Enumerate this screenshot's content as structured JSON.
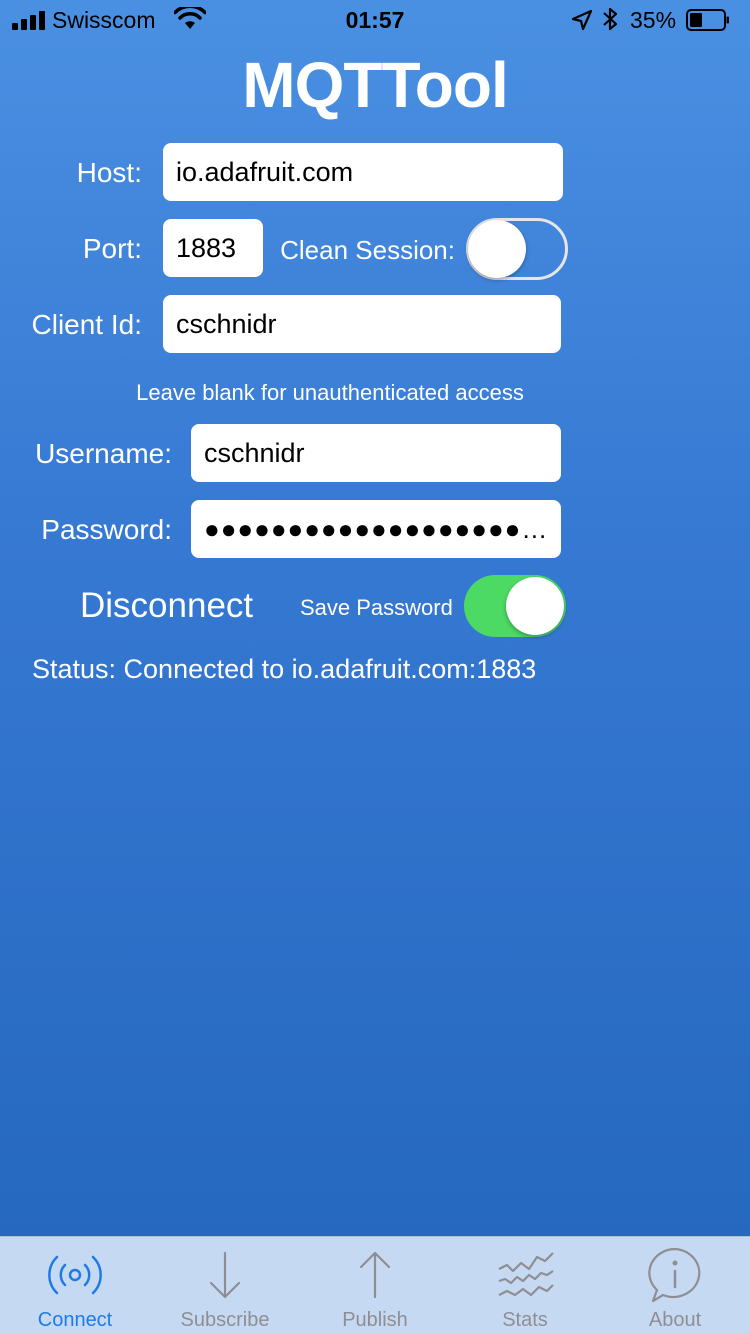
{
  "status_bar": {
    "carrier": "Swisscom",
    "time": "01:57",
    "battery": "35%"
  },
  "app": {
    "title": "MQTTool"
  },
  "form": {
    "host_label": "Host:",
    "host_value": "io.adafruit.com",
    "port_label": "Port:",
    "port_value": "1883",
    "clean_session_label": "Clean Session:",
    "clean_session_on": false,
    "client_id_label": "Client Id:",
    "client_id_value": "cschnidr",
    "auth_hint": "Leave blank for unauthenticated access",
    "username_label": "Username:",
    "username_value": "cschnidr",
    "password_label": "Password:",
    "password_value": "●●●●●●●●●●●●●●●●●●●…",
    "disconnect_label": "Disconnect",
    "save_password_label": "Save Password",
    "save_password_on": true,
    "status_text": "Status: Connected to io.adafruit.com:1883"
  },
  "tabs": [
    {
      "label": "Connect",
      "icon": "broadcast-icon",
      "active": true
    },
    {
      "label": "Subscribe",
      "icon": "arrow-down-icon",
      "active": false
    },
    {
      "label": "Publish",
      "icon": "arrow-up-icon",
      "active": false
    },
    {
      "label": "Stats",
      "icon": "stats-icon",
      "active": false
    },
    {
      "label": "About",
      "icon": "info-bubble-icon",
      "active": false
    }
  ],
  "colors": {
    "accent": "#1e7be6",
    "toggle_on": "#4cd964",
    "background_top": "#4a90e2",
    "background_bottom": "#2366bd"
  }
}
